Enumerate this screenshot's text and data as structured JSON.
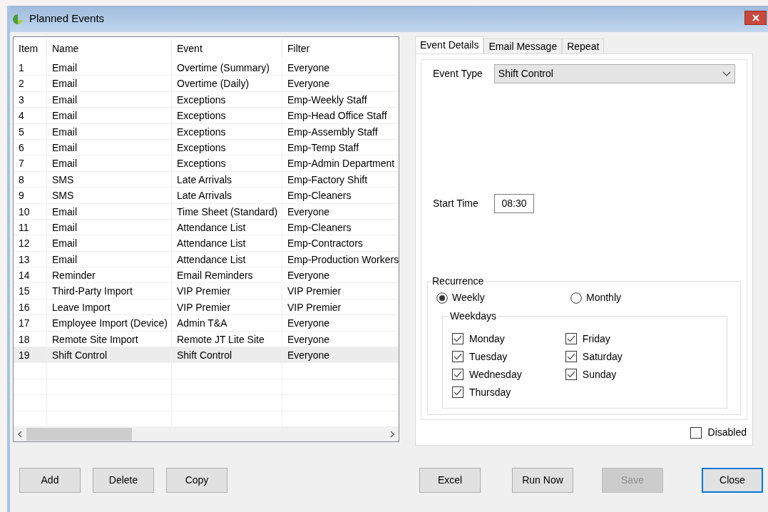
{
  "window": {
    "title": "Planned Events"
  },
  "table": {
    "columns": [
      "Item",
      "Name",
      "Event",
      "Filter"
    ],
    "rows": [
      {
        "cells": [
          "1",
          "Email",
          "Overtime (Summary)",
          "Everyone"
        ],
        "selected": false
      },
      {
        "cells": [
          "2",
          "Email",
          "Overtime (Daily)",
          "Everyone"
        ],
        "selected": false
      },
      {
        "cells": [
          "3",
          "Email",
          "Exceptions",
          "Emp-Weekly Staff"
        ],
        "selected": false
      },
      {
        "cells": [
          "4",
          "Email",
          "Exceptions",
          "Emp-Head Office Staff"
        ],
        "selected": false
      },
      {
        "cells": [
          "5",
          "Email",
          "Exceptions",
          "Emp-Assembly Staff"
        ],
        "selected": false
      },
      {
        "cells": [
          "6",
          "Email",
          "Exceptions",
          "Emp-Temp Staff"
        ],
        "selected": false
      },
      {
        "cells": [
          "7",
          "Email",
          "Exceptions",
          "Emp-Admin Department"
        ],
        "selected": false
      },
      {
        "cells": [
          "8",
          "SMS",
          "Late Arrivals",
          "Emp-Factory Shift"
        ],
        "selected": false
      },
      {
        "cells": [
          "9",
          "SMS",
          "Late Arrivals",
          "Emp-Cleaners"
        ],
        "selected": false
      },
      {
        "cells": [
          "10",
          "Email",
          "Time Sheet (Standard)",
          "Everyone"
        ],
        "selected": false
      },
      {
        "cells": [
          "11",
          "Email",
          "Attendance List",
          "Emp-Cleaners"
        ],
        "selected": false
      },
      {
        "cells": [
          "12",
          "Email",
          "Attendance List",
          "Emp-Contractors"
        ],
        "selected": false
      },
      {
        "cells": [
          "13",
          "Email",
          "Attendance List",
          "Emp-Production Workers"
        ],
        "selected": false
      },
      {
        "cells": [
          "14",
          "Reminder",
          "Email Reminders",
          "Everyone"
        ],
        "selected": false
      },
      {
        "cells": [
          "15",
          "Third-Party Import",
          "VIP Premier",
          "VIP Premier"
        ],
        "selected": false
      },
      {
        "cells": [
          "16",
          "Leave Import",
          "VIP Premier",
          "VIP Premier"
        ],
        "selected": false
      },
      {
        "cells": [
          "17",
          "Employee Import (Device)",
          "Admin T&A",
          "Everyone"
        ],
        "selected": false
      },
      {
        "cells": [
          "18",
          "Remote Site Import",
          "Remote JT Lite Site",
          "Everyone"
        ],
        "selected": false
      },
      {
        "cells": [
          "19",
          "Shift Control",
          "Shift Control",
          "Everyone"
        ],
        "selected": true
      }
    ]
  },
  "tabs": [
    {
      "label": "Event Details",
      "selected": true
    },
    {
      "label": "Email Message",
      "selected": false
    },
    {
      "label": "Repeat",
      "selected": false
    }
  ],
  "event_type": {
    "label": "Event Type",
    "value": "Shift Control"
  },
  "start_time": {
    "label": "Start Time",
    "value": "08:30"
  },
  "recurrence": {
    "title": "Recurrence",
    "options": [
      {
        "label": "Weekly",
        "selected": true
      },
      {
        "label": "Monthly",
        "selected": false
      }
    ],
    "weekdays": {
      "title": "Weekdays",
      "days": [
        {
          "label": "Monday",
          "checked": true
        },
        {
          "label": "Tuesday",
          "checked": true
        },
        {
          "label": "Wednesday",
          "checked": true
        },
        {
          "label": "Thursday",
          "checked": true
        },
        {
          "label": "Friday",
          "checked": true
        },
        {
          "label": "Saturday",
          "checked": true
        },
        {
          "label": "Sunday",
          "checked": true
        }
      ]
    }
  },
  "disabled_checkbox": {
    "label": "Disabled",
    "checked": false
  },
  "left_buttons": [
    {
      "label": "Add",
      "disabled": false,
      "focused": false
    },
    {
      "label": "Delete",
      "disabled": false,
      "focused": false
    },
    {
      "label": "Copy",
      "disabled": false,
      "focused": false
    }
  ],
  "right_buttons": [
    {
      "label": "Excel",
      "disabled": false,
      "focused": false
    },
    {
      "label": "Run Now",
      "disabled": false,
      "focused": false
    },
    {
      "label": "Save",
      "disabled": true,
      "focused": false
    },
    {
      "label": "Close",
      "disabled": false,
      "focused": true
    }
  ]
}
